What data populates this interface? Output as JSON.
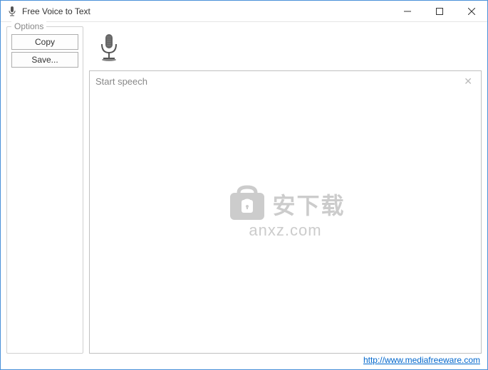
{
  "window": {
    "title": "Free Voice to Text"
  },
  "sidebar": {
    "legend": "Options",
    "copy_label": "Copy",
    "save_label": "Save..."
  },
  "textarea": {
    "placeholder": "Start speech"
  },
  "watermark": {
    "text1": "安下载",
    "text2": "anxz.com"
  },
  "footer": {
    "link_text": "http://www.mediafreeware.com"
  }
}
